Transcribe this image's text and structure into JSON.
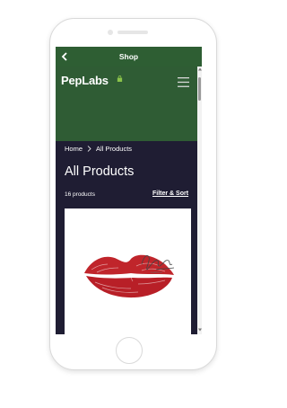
{
  "topbar": {
    "title": "Shop",
    "back_icon": "chevron-left-icon"
  },
  "header": {
    "logo_text": "PepLabs",
    "logo_icon": "shopping-bag-icon",
    "menu_icon": "hamburger-menu-icon",
    "background": "#2f5c34"
  },
  "breadcrumb": {
    "home": "Home",
    "separator_icon": "chevron-right-icon",
    "current": "All Products"
  },
  "page": {
    "title": "All Products",
    "product_count": "16 products",
    "filter_label": "Filter & Sort",
    "background": "#1f1d33"
  },
  "products": [
    {
      "image_icon": "lipstick-kiss-print",
      "signature": "LaVerish"
    }
  ],
  "colors": {
    "accent_green": "#2e5e33",
    "lip_red": "#c0252b"
  }
}
